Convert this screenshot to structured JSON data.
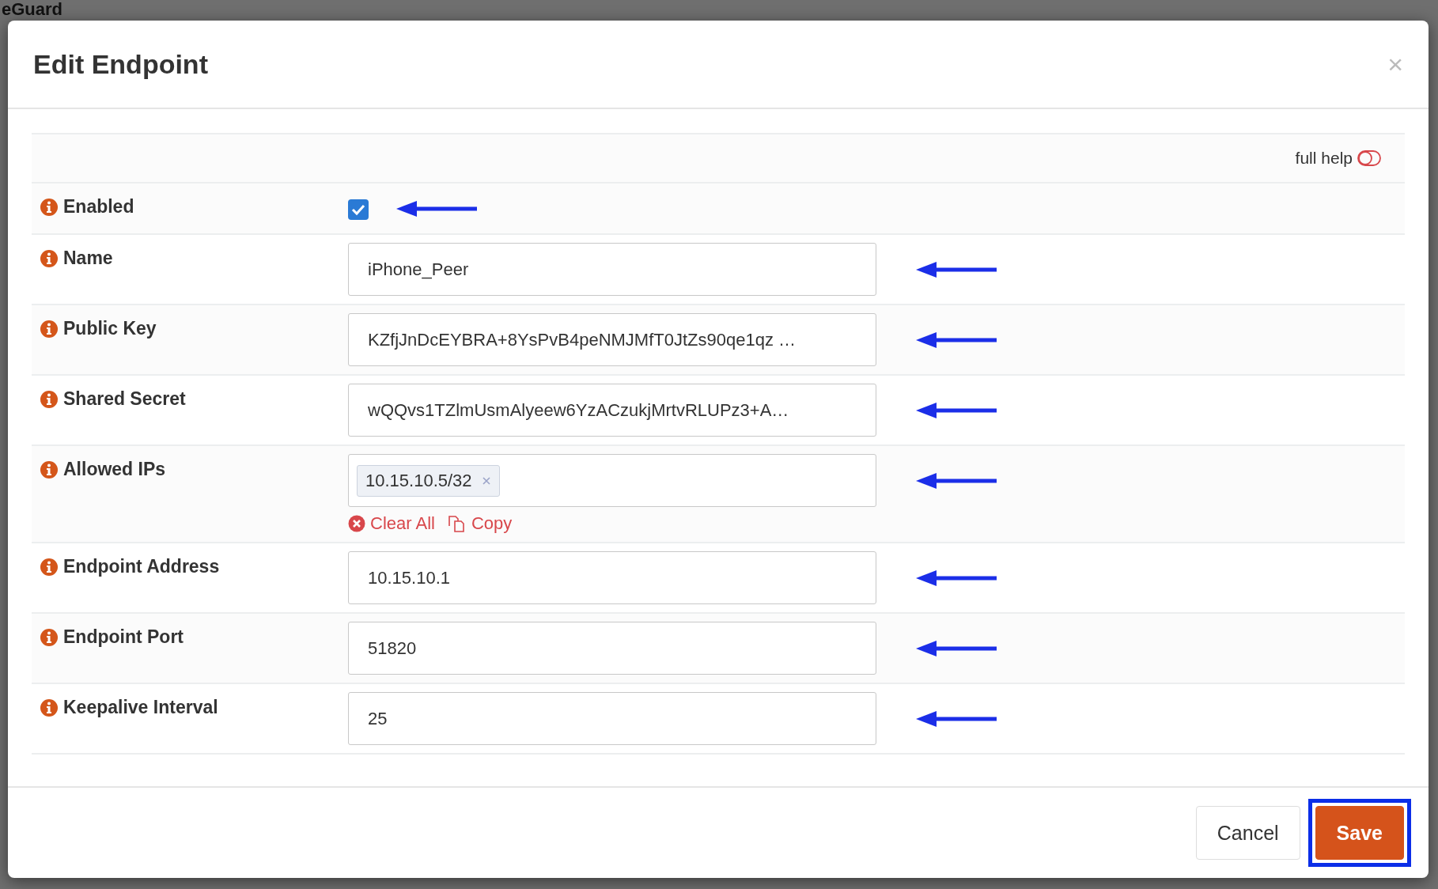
{
  "background": {
    "title": "eGuard"
  },
  "modal": {
    "title": "Edit Endpoint",
    "close": "×"
  },
  "help": {
    "label": "full help",
    "on": false
  },
  "rows": [
    {
      "kind": "checkbox",
      "label": "Enabled",
      "checked": true,
      "annotated": true
    },
    {
      "kind": "text",
      "label": "Name",
      "value": "iPhone_Peer",
      "annotated": true
    },
    {
      "kind": "text",
      "label": "Public Key",
      "value": "KZfjJnDcEYBRA+8YsPvB4peNMJMfT0JtZs90qe1qz …",
      "annotated": true
    },
    {
      "kind": "text",
      "label": "Shared Secret",
      "value": "wQQvs1TZlmUsmAlyeew6YzACzukjMrtvRLUPz3+A…",
      "annotated": true
    },
    {
      "kind": "tags",
      "label": "Allowed IPs",
      "tags": [
        "10.15.10.5/32"
      ],
      "actions": [
        "Clear All",
        "Copy"
      ],
      "annotated": true
    },
    {
      "kind": "text",
      "label": "Endpoint Address",
      "value": "10.15.10.1",
      "annotated": true
    },
    {
      "kind": "text",
      "label": "Endpoint Port",
      "value": "51820",
      "annotated": true
    },
    {
      "kind": "text",
      "label": "Keepalive Interval",
      "value": "25",
      "annotated": true
    }
  ],
  "buttons": [
    {
      "kind": "secondary",
      "label": "Cancel",
      "highlighted": false
    },
    {
      "kind": "primary",
      "label": "Save",
      "highlighted": true
    }
  ]
}
